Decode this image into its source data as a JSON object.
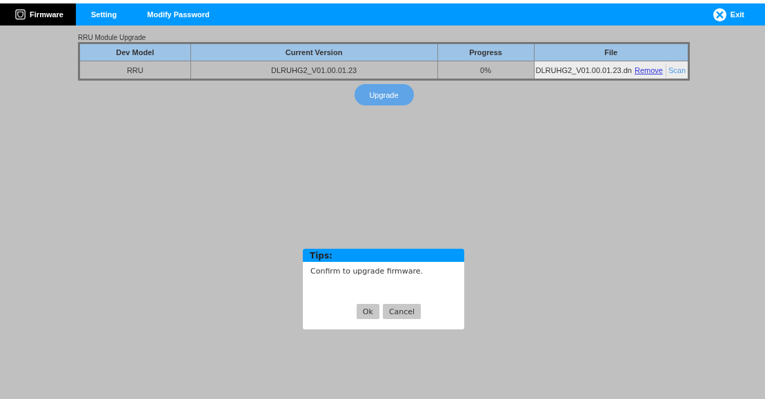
{
  "nav": {
    "items": [
      {
        "label": "Firmware",
        "selected": true
      },
      {
        "label": "Setting",
        "selected": false
      },
      {
        "label": "Modify Password",
        "selected": false
      }
    ],
    "exit": "Exit"
  },
  "upgrade": {
    "title": "RRU Module Upgrade",
    "columns": [
      "Dev Model",
      "Current Version",
      "Progress",
      "File"
    ],
    "rows": [
      {
        "dev_model": "RRU",
        "current_version": "DLRUHG2_V01.00.01.23",
        "progress": "0%",
        "file": "DLRUHG2_V01.00.01.23.dn",
        "remove": "Remove",
        "scan": "Scan"
      }
    ],
    "button": "Upgrade"
  },
  "dialog": {
    "title": "Tips:",
    "message": "Confirm to upgrade firmware.",
    "buttons": [
      "Ok",
      "Cancel"
    ]
  }
}
